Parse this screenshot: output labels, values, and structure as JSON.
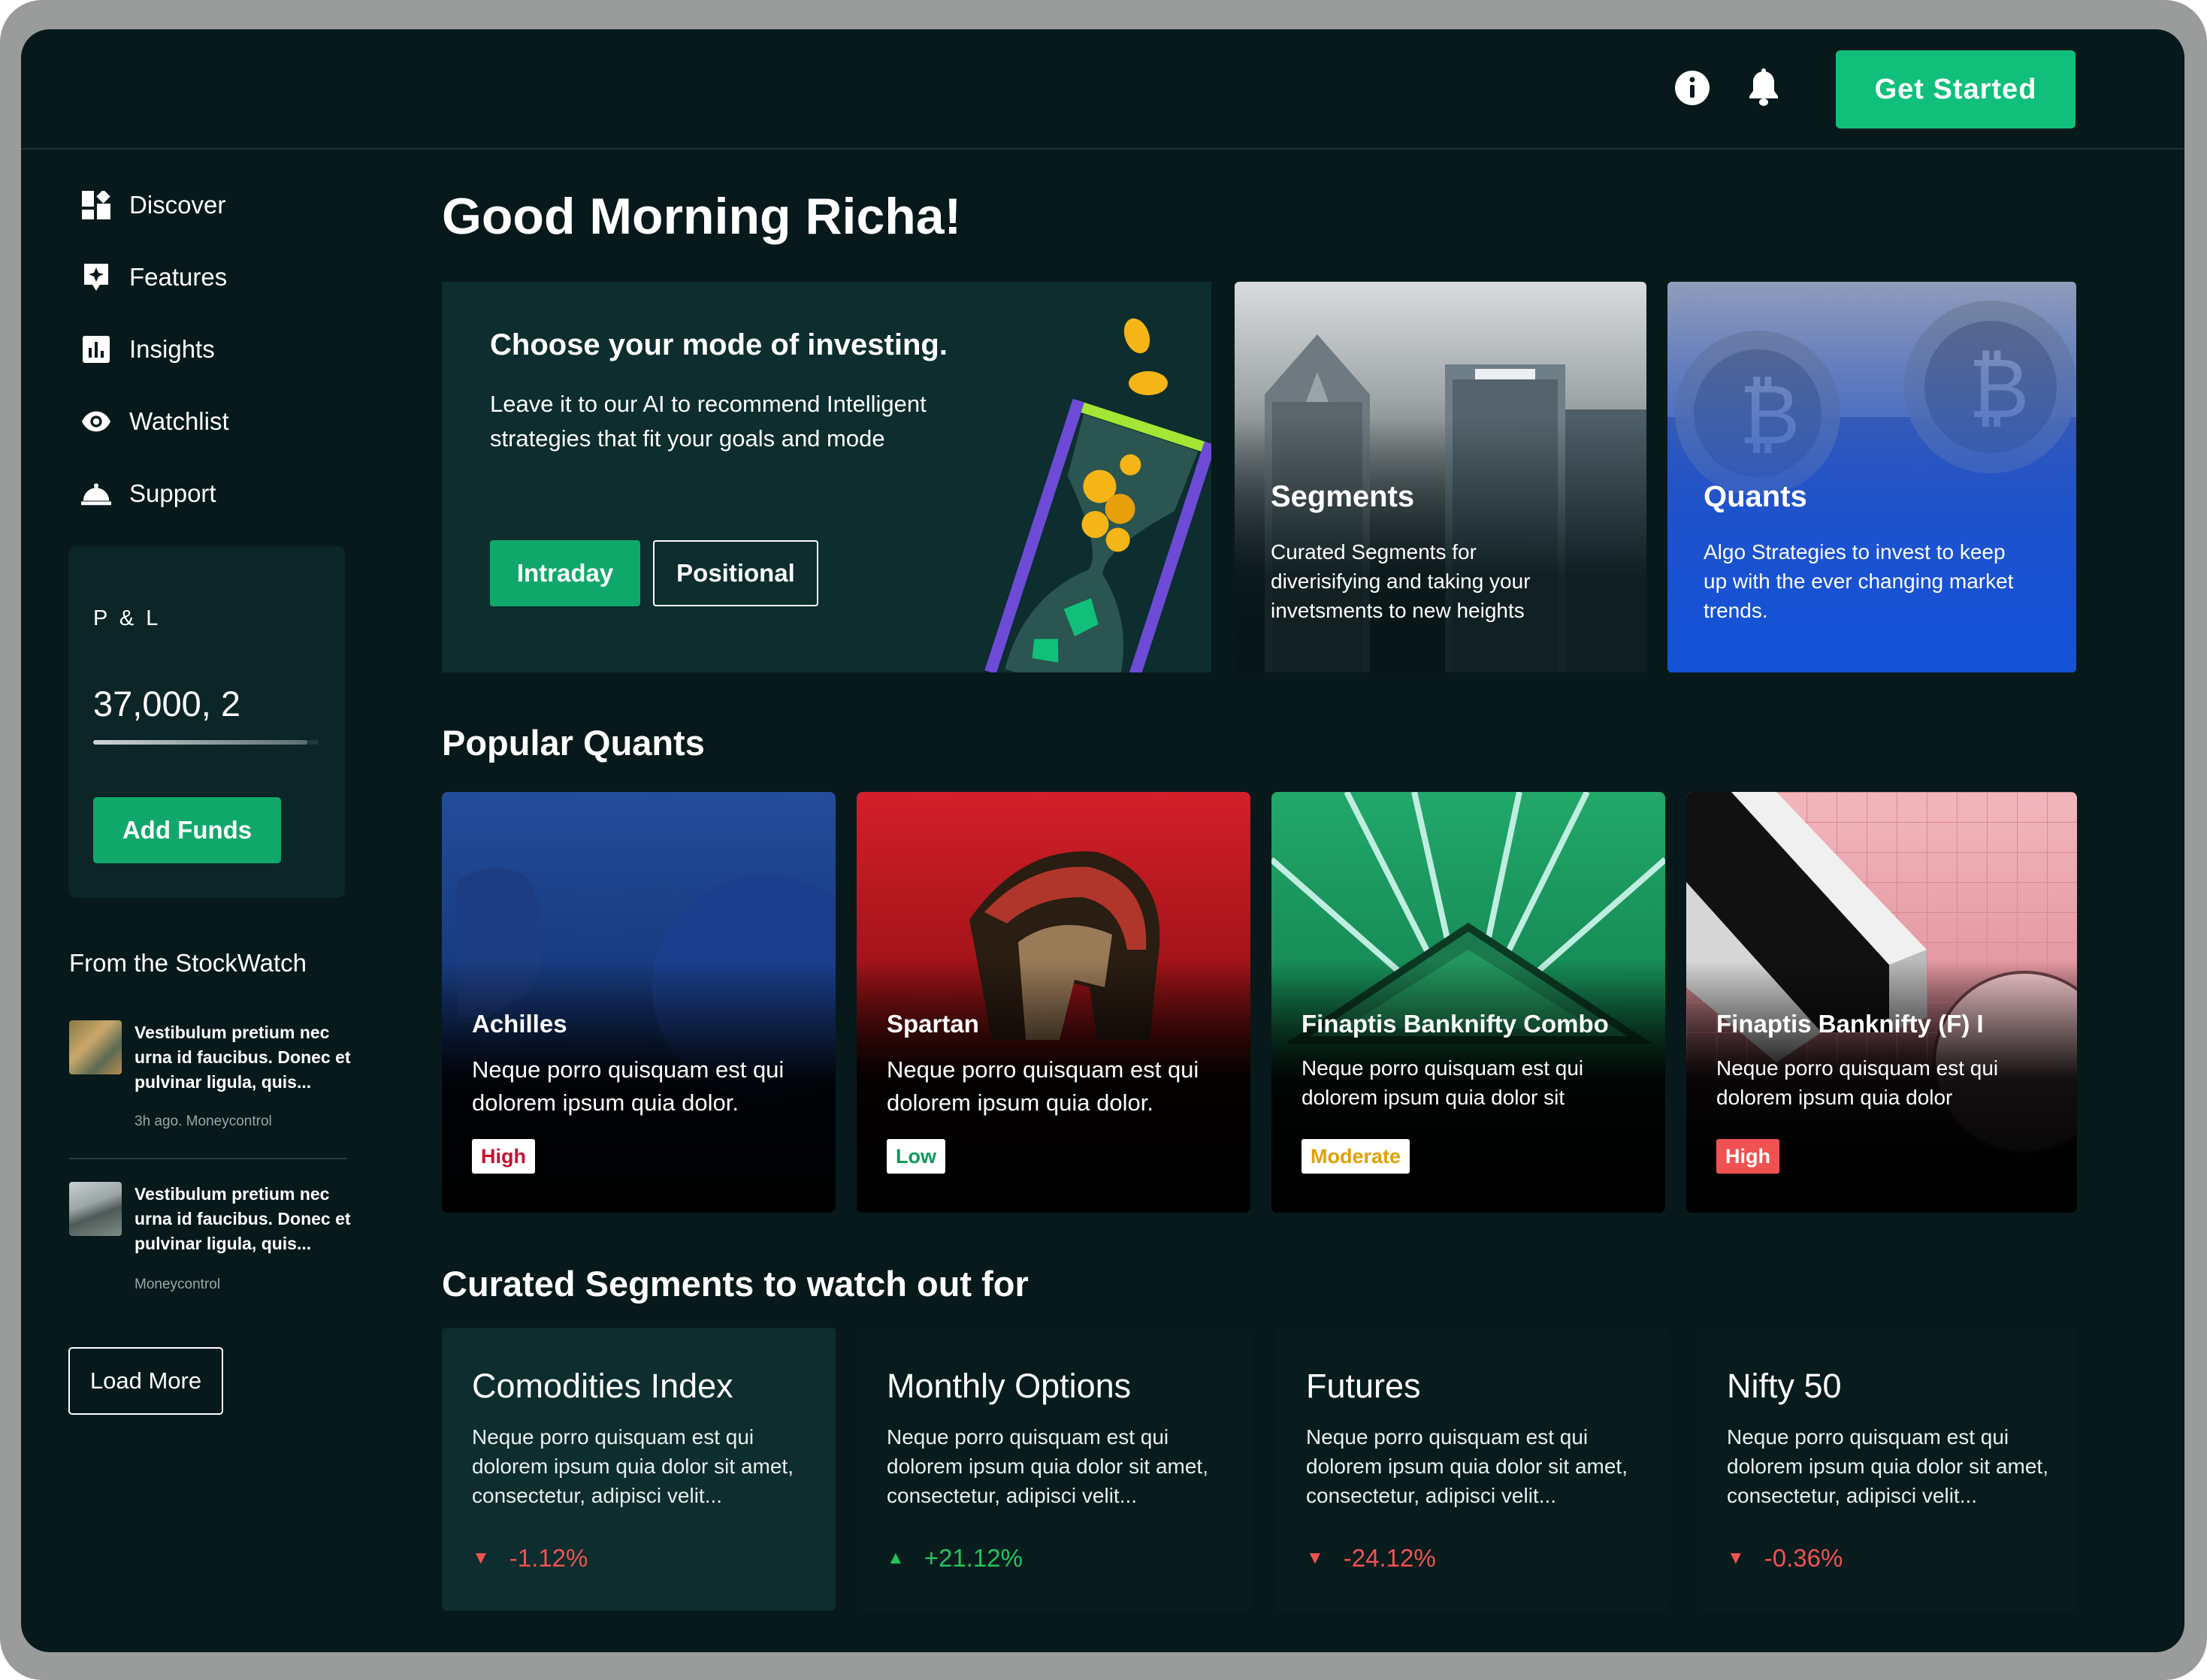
{
  "topbar": {
    "cta_label": "Get Started",
    "icons": [
      "info-icon",
      "bell-icon"
    ]
  },
  "sidebar": {
    "items": [
      {
        "label": "Discover",
        "icon": "grid-icon"
      },
      {
        "label": "Features",
        "icon": "sparkle-icon"
      },
      {
        "label": "Insights",
        "icon": "bar-chart-icon"
      },
      {
        "label": "Watchlist",
        "icon": "eye-icon"
      },
      {
        "label": "Support",
        "icon": "bell-support-icon"
      }
    ],
    "pnl": {
      "label": "P & L",
      "value": "37,000, 2",
      "bar_level": 0.95,
      "add_funds_label": "Add Funds"
    },
    "news": {
      "title": "From the StockWatch",
      "items": [
        {
          "text": "Vestibulum pretium nec urna id faucibus. Donec et pulvinar ligula, quis...",
          "meta": "3h ago. Moneycontrol"
        },
        {
          "text": "Vestibulum pretium nec urna id faucibus. Donec et pulvinar ligula, quis...",
          "meta": "Moneycontrol"
        }
      ],
      "load_more_label": "Load More"
    }
  },
  "main": {
    "greeting": "Good Morning Richa!",
    "invest": {
      "title": "Choose your mode of investing.",
      "description": "Leave it to our AI to recommend Intelligent strategies that fit your goals and mode",
      "modes": [
        "Intraday",
        "Positional"
      ]
    },
    "features": [
      {
        "title": "Segments",
        "description": "Curated Segments for diverisifying and taking your invetsments  to new heights"
      },
      {
        "title": "Quants",
        "description": "Algo Strategies to invest to keep up with the ever changing market trends."
      }
    ],
    "popular_quants": {
      "title": "Popular Quants",
      "items": [
        {
          "name": "Achilles",
          "description": "Neque porro quisquam est qui dolorem ipsum quia dolor.",
          "risk": "High",
          "risk_color": "#c8102e"
        },
        {
          "name": "Spartan",
          "description": "Neque porro quisquam est qui dolorem ipsum quia dolor.",
          "risk": "Low",
          "risk_color": "#0e9a5e"
        },
        {
          "name": "Finaptis Banknifty Combo",
          "description": "Neque porro quisquam est qui dolorem ipsum quia dolor sit",
          "risk": "Moderate",
          "risk_color": "#e0a100"
        },
        {
          "name": "Finaptis Banknifty (F) I",
          "description": "Neque porro quisquam est qui dolorem ipsum quia dolor",
          "risk": "High",
          "risk_color": "#f05252"
        }
      ]
    },
    "curated_segments": {
      "title": "Curated Segments to watch out for",
      "items": [
        {
          "name": "Comodities Index",
          "description": "Neque porro quisquam est qui dolorem ipsum quia dolor sit amet, consectetur, adipisci velit...",
          "change": "-1.12%",
          "direction": "down"
        },
        {
          "name": "Monthly Options",
          "description": "Neque porro quisquam est qui dolorem ipsum quia dolor sit amet, consectetur, adipisci velit...",
          "change": "+21.12%",
          "direction": "up"
        },
        {
          "name": "Futures",
          "description": "Neque porro quisquam est qui dolorem ipsum quia dolor sit amet, consectetur, adipisci velit...",
          "change": "-24.12%",
          "direction": "down"
        },
        {
          "name": "Nifty 50",
          "description": "Neque porro quisquam est qui dolorem ipsum quia dolor sit amet, consectetur, adipisci velit...",
          "change": "-0.36%",
          "direction": "down"
        }
      ]
    }
  },
  "colors": {
    "background": "#07191b",
    "accent": "#10c07a",
    "positive": "#22c55e",
    "negative": "#ef4444"
  }
}
